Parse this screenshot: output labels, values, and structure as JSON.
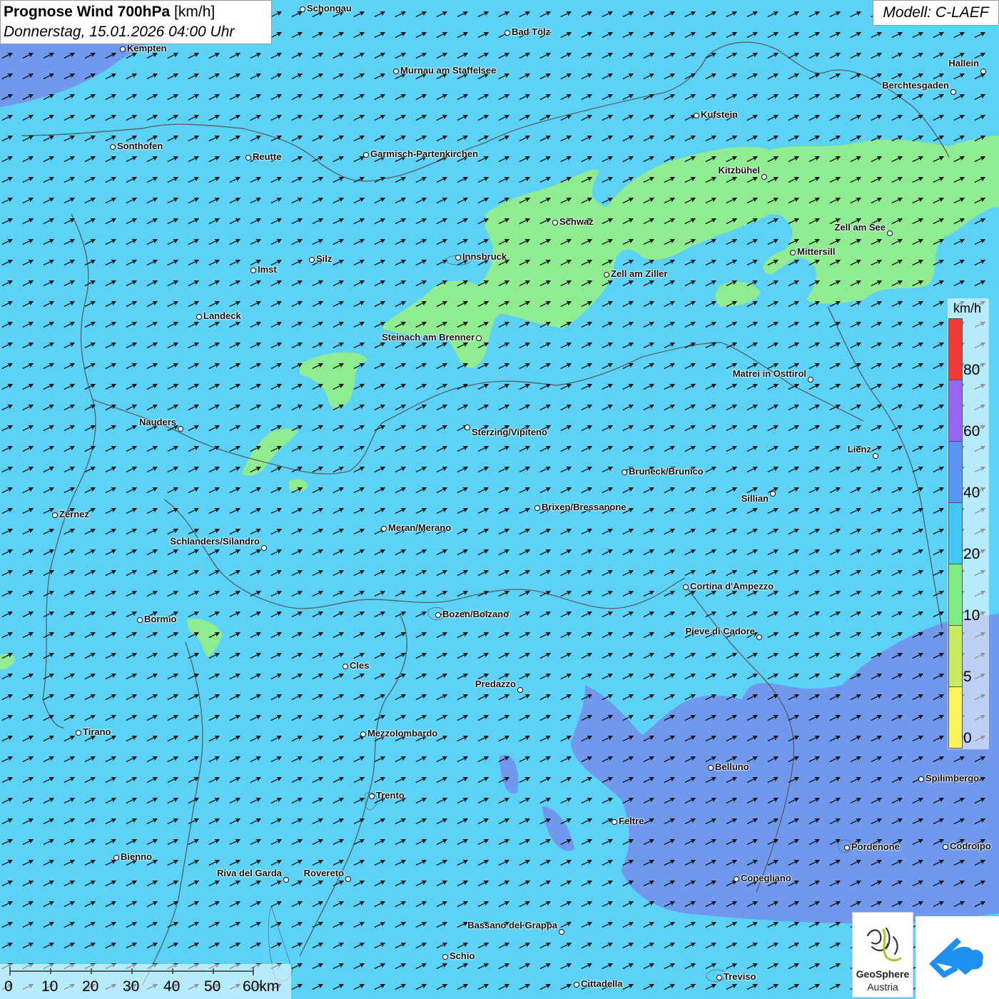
{
  "header": {
    "title_bold": "Prognose Wind 700hPa",
    "title_unit": "[km/h]",
    "datetime": "Donnerstag, 15.01.2026 04:00 Uhr",
    "model": "Modell: C-LAEF"
  },
  "legend": {
    "unit": "km/h",
    "ticks": [
      "0",
      "5",
      "10",
      "20",
      "40",
      "60",
      "80"
    ],
    "colors": [
      "#fbf25c",
      "#c8ec60",
      "#80ec80",
      "#44c8f2",
      "#5c96f2",
      "#9666f2",
      "#f23a3a"
    ]
  },
  "scale": {
    "ticks": [
      "0",
      "10",
      "20",
      "30",
      "40",
      "50",
      "60km"
    ]
  },
  "logos": {
    "geosphere_line1": "GeoSphere",
    "geosphere_line2": "Austria",
    "geosphere_icon": "geosphere-logo",
    "cloud_icon": "cloud-arrow-logo"
  },
  "colors": {
    "wind_20_40": "#5cd2f6",
    "wind_10_20": "#90ec90",
    "wind_40_60": "#6c96f0",
    "arrow": "#111111",
    "border": "#555555"
  },
  "wind": {
    "direction": "towards north-east",
    "arrow_icon": "wind-arrow"
  },
  "cities": [
    {
      "name": "Schongau"
    },
    {
      "name": "Bad Tölz"
    },
    {
      "name": "Kempten"
    },
    {
      "name": "Murnau am Staffelsee"
    },
    {
      "name": "Hallein"
    },
    {
      "name": "Berchtesgaden"
    },
    {
      "name": "Kufstein"
    },
    {
      "name": "Sonthofen"
    },
    {
      "name": "Reutte"
    },
    {
      "name": "Garmisch-Partenkirchen"
    },
    {
      "name": "Kitzbühel"
    },
    {
      "name": "Schwaz"
    },
    {
      "name": "Zell am See"
    },
    {
      "name": "Mittersill"
    },
    {
      "name": "Innsbruck"
    },
    {
      "name": "Silz"
    },
    {
      "name": "Imst"
    },
    {
      "name": "Zell am Ziller"
    },
    {
      "name": "Landeck"
    },
    {
      "name": "Steinach am Brenner"
    },
    {
      "name": "Matrei in Osttirol"
    },
    {
      "name": "Nauders"
    },
    {
      "name": "Sterzing/Vipiteno"
    },
    {
      "name": "Lienz"
    },
    {
      "name": "Bruneck/Brunico"
    },
    {
      "name": "Sillian"
    },
    {
      "name": "Zernez"
    },
    {
      "name": "Brixen/Bressanone"
    },
    {
      "name": "Meran/Merano"
    },
    {
      "name": "Schlanders/Silandro"
    },
    {
      "name": "Cortina d'Ampezzo"
    },
    {
      "name": "Bozen/Bolzano"
    },
    {
      "name": "Bormio"
    },
    {
      "name": "Pieve di Cadore"
    },
    {
      "name": "Cles"
    },
    {
      "name": "Predazzo"
    },
    {
      "name": "Tirano"
    },
    {
      "name": "Mezzolombardo"
    },
    {
      "name": "Belluno"
    },
    {
      "name": "Spilimbergo"
    },
    {
      "name": "Trento"
    },
    {
      "name": "Feltre"
    },
    {
      "name": "Bienno"
    },
    {
      "name": "Pordenone"
    },
    {
      "name": "Codroipo"
    },
    {
      "name": "Riva del Garda"
    },
    {
      "name": "Rovereto"
    },
    {
      "name": "Conegliano"
    },
    {
      "name": "Bassano del Grappa"
    },
    {
      "name": "Schio"
    },
    {
      "name": "Treviso"
    },
    {
      "name": "Cittadella"
    }
  ]
}
